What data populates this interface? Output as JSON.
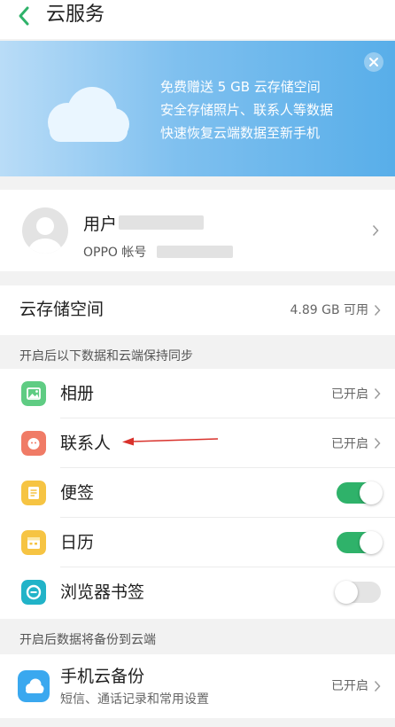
{
  "header": {
    "title": "云服务",
    "back_icon": "chevron-left-icon",
    "accent_color": "#2fb26a"
  },
  "banner": {
    "lines": [
      "免费赠送 5 GB 云存储空间",
      "安全存储照片、联系人等数据",
      "快速恢复云端数据至新手机"
    ],
    "illustration": "cloud-icon",
    "close_icon": "close-circle-icon"
  },
  "account": {
    "name_visible": "用户",
    "label": "OPPO 帐号",
    "avatar_icon": "default-avatar-icon",
    "chevron_icon": "chevron-right-icon"
  },
  "storage": {
    "title": "云存储空间",
    "value": "4.89 GB 可用"
  },
  "sync_section": {
    "header": "开启后以下数据和云端保持同步",
    "items": [
      {
        "label": "相册",
        "icon": "photo-album-icon",
        "icon_color": "#5fcc83",
        "status": "已开启"
      },
      {
        "label": "联系人",
        "icon": "contacts-icon",
        "icon_color": "#f07b66",
        "status": "已开启"
      },
      {
        "label": "便签",
        "icon": "notes-icon",
        "icon_color": "#f6c443",
        "toggle": true
      },
      {
        "label": "日历",
        "icon": "calendar-icon",
        "icon_color": "#f6c443",
        "toggle": true
      },
      {
        "label": "浏览器书签",
        "icon": "browser-bookmark-icon",
        "icon_color": "#21b3c8",
        "toggle": false
      }
    ]
  },
  "backup_section": {
    "header": "开启后数据将备份到云端",
    "title": "手机云备份",
    "subtitle": "短信、通话记录和常用设置",
    "status": "已开启",
    "icon": "cloud-backup-icon",
    "icon_color": "#3aa8ef"
  },
  "annotation": {
    "arrow_color": "#d9322c"
  }
}
